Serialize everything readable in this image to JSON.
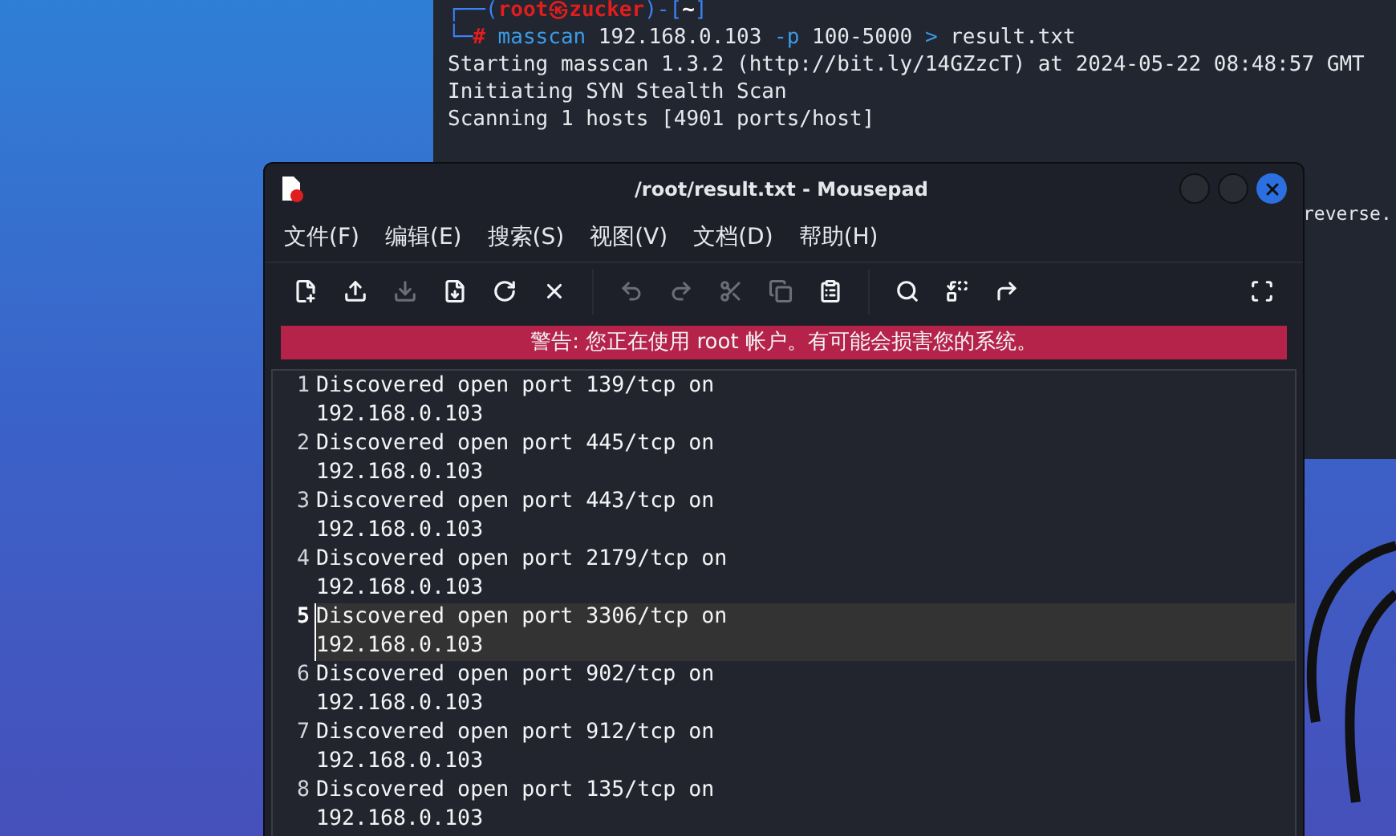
{
  "terminal": {
    "lines": [
      {
        "segments": [
          {
            "kind": "frame",
            "text": "┌──("
          },
          {
            "kind": "user",
            "text": "root㉿zucker"
          },
          {
            "kind": "frame",
            "text": ")-["
          },
          {
            "kind": "path",
            "text": "~"
          },
          {
            "kind": "frame",
            "text": "]"
          }
        ]
      },
      {
        "segments": [
          {
            "kind": "frame",
            "text": "└─"
          },
          {
            "kind": "user",
            "text": "#"
          },
          {
            "kind": "command",
            "text": " masscan"
          },
          {
            "kind": "plain",
            "text": " 192.168.0.103 "
          },
          {
            "kind": "option",
            "text": "-p"
          },
          {
            "kind": "plain",
            "text": " 100-5000 "
          },
          {
            "kind": "command",
            "text": ">"
          },
          {
            "kind": "plain",
            "text": " result.txt"
          }
        ]
      },
      {
        "segments": [
          {
            "kind": "plain",
            "text": "Starting masscan 1.3.2 (http://bit.ly/14GZzcT) at 2024-05-22 08:48:57 GMT"
          }
        ]
      },
      {
        "segments": [
          {
            "kind": "plain",
            "text": "Initiating SYN Stealth Scan"
          }
        ]
      },
      {
        "segments": [
          {
            "kind": "plain",
            "text": "Scanning 1 hosts [4901 ports/host]"
          }
        ]
      }
    ],
    "peek_text": "reverse."
  },
  "window": {
    "title": "/root/result.txt - Mousepad",
    "menu": [
      "文件(F)",
      "编辑(E)",
      "搜索(S)",
      "视图(V)",
      "文档(D)",
      "帮助(H)"
    ],
    "toolbar": [
      {
        "kind": "new",
        "disabled": false
      },
      {
        "kind": "open",
        "disabled": false
      },
      {
        "kind": "save",
        "disabled": true
      },
      {
        "kind": "save-as",
        "disabled": false
      },
      {
        "kind": "reload",
        "disabled": false
      },
      {
        "kind": "close",
        "disabled": false
      },
      {
        "kind": "sep"
      },
      {
        "kind": "undo",
        "disabled": true
      },
      {
        "kind": "redo",
        "disabled": true
      },
      {
        "kind": "cut",
        "disabled": true
      },
      {
        "kind": "copy",
        "disabled": true
      },
      {
        "kind": "paste",
        "disabled": false
      },
      {
        "kind": "sep"
      },
      {
        "kind": "find",
        "disabled": false
      },
      {
        "kind": "replace",
        "disabled": false
      },
      {
        "kind": "goto",
        "disabled": false
      },
      {
        "kind": "spacer"
      },
      {
        "kind": "fullscreen",
        "disabled": false
      }
    ],
    "warning": "警告: 您正在使用 root 帐户。有可能会损害您的系统。",
    "lines": [
      {
        "number": "1",
        "text": "Discovered open port 139/tcp on 192.168.0.103",
        "selected": false
      },
      {
        "number": "2",
        "text": "Discovered open port 445/tcp on 192.168.0.103",
        "selected": false
      },
      {
        "number": "3",
        "text": "Discovered open port 443/tcp on 192.168.0.103",
        "selected": false
      },
      {
        "number": "4",
        "text": "Discovered open port 2179/tcp on 192.168.0.103",
        "selected": false
      },
      {
        "number": "5",
        "text": "Discovered open port 3306/tcp on 192.168.0.103",
        "selected": true
      },
      {
        "number": "6",
        "text": "Discovered open port 902/tcp on 192.168.0.103",
        "selected": false
      },
      {
        "number": "7",
        "text": "Discovered open port 912/tcp on 192.168.0.103",
        "selected": false
      },
      {
        "number": "8",
        "text": "Discovered open port 135/tcp on 192.168.0.103",
        "selected": false
      }
    ]
  }
}
